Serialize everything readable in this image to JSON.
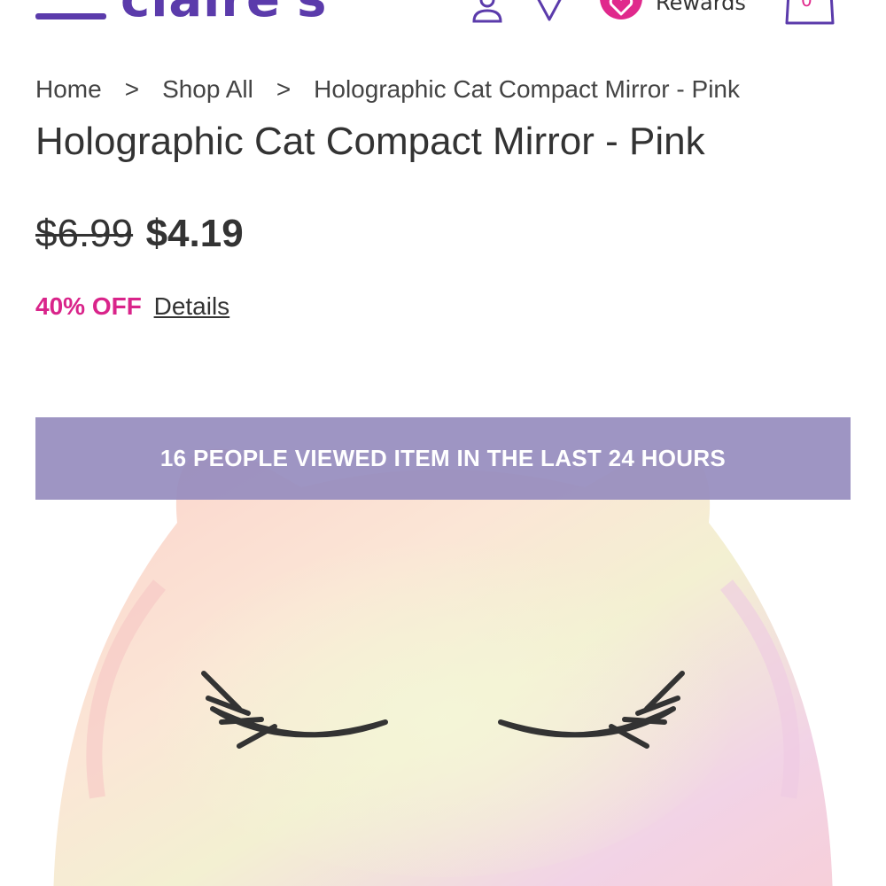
{
  "header": {
    "logo_text": "claire's",
    "rewards_label": "Rewards",
    "bag_count": "0",
    "icons": [
      "menu-icon",
      "account-icon",
      "store-locator-icon",
      "rewards-heart-icon",
      "shopping-bag-icon"
    ],
    "brand_color": "#5b3bab",
    "accent_color": "#e0298c"
  },
  "breadcrumb": {
    "items": [
      "Home",
      "Shop All",
      "Holographic Cat Compact Mirror - Pink"
    ],
    "separator": ">"
  },
  "product": {
    "title": "Holographic Cat Compact Mirror - Pink",
    "original_price": "$6.99",
    "sale_price": "$4.19",
    "discount": "40% OFF",
    "details_link": "Details",
    "viewed_banner": "16 PEOPLE VIEWED ITEM IN THE LAST 24 HOURS",
    "image_subject": "holographic pink cat compact mirror with closed eyelashes"
  }
}
